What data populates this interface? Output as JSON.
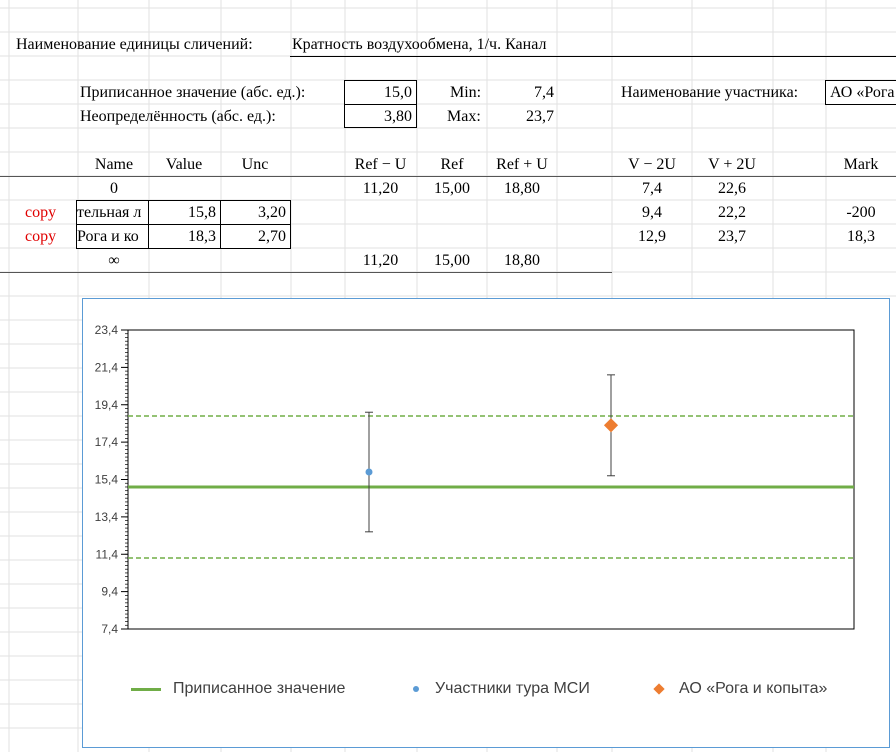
{
  "header": {
    "label": "Наименование единицы сличений:",
    "value": "Кратность воздухообмена, 1/ч. Канал"
  },
  "params": {
    "assigned_label": "Приписанное значение (абс. ед.):",
    "assigned_value": "15,0",
    "uncertainty_label": "Неопределённость (абс. ед.):",
    "uncertainty_value": "3,80",
    "min_label": "Min:",
    "min_value": "7,4",
    "max_label": "Max:",
    "max_value": "23,7",
    "participant_label": "Наименование участника:",
    "participant_value": "АО «Рога"
  },
  "table": {
    "headers": {
      "name": "Name",
      "value": "Value",
      "unc": "Unc",
      "ref_minus_u": "Ref − U",
      "ref": "Ref",
      "ref_plus_u": "Ref + U",
      "v_minus_2u": "V − 2U",
      "v_plus_2u": "V + 2U",
      "mark": "Mark"
    },
    "rows": [
      {
        "copy": "",
        "name": "0",
        "value": "",
        "unc": "",
        "ref_minus_u": "11,20",
        "ref": "15,00",
        "ref_plus_u": "18,80",
        "v_minus_2u": "7,4",
        "v_plus_2u": "22,6",
        "mark": ""
      },
      {
        "copy": "copy",
        "name": "тельная л",
        "value": "15,8",
        "unc": "3,20",
        "ref_minus_u": "",
        "ref": "",
        "ref_plus_u": "",
        "v_minus_2u": "9,4",
        "v_plus_2u": "22,2",
        "mark": "-200"
      },
      {
        "copy": "copy",
        "name": "Рога и ко",
        "value": "18,3",
        "unc": "2,70",
        "ref_minus_u": "",
        "ref": "",
        "ref_plus_u": "",
        "v_minus_2u": "12,9",
        "v_plus_2u": "23,7",
        "mark": "18,3"
      },
      {
        "copy": "",
        "name": "∞",
        "value": "",
        "unc": "",
        "ref_minus_u": "11,20",
        "ref": "15,00",
        "ref_plus_u": "18,80",
        "v_minus_2u": "",
        "v_plus_2u": "",
        "mark": ""
      }
    ]
  },
  "chart_data": {
    "type": "scatter",
    "ylim": [
      7.4,
      23.4
    ],
    "y_ticks": [
      "23,4",
      "21,4",
      "19,4",
      "17,4",
      "15,4",
      "13,4",
      "11,4",
      "9,4",
      "7,4"
    ],
    "y_tick_values": [
      23.4,
      21.4,
      19.4,
      17.4,
      15.4,
      13.4,
      11.4,
      9.4,
      7.4
    ],
    "assigned_value": 15.0,
    "ref_minus_u": 11.2,
    "ref_plus_u": 18.8,
    "series": [
      {
        "name": "Участники тура МСИ",
        "points": [
          {
            "value": 15.8,
            "unc": 3.2
          }
        ]
      },
      {
        "name": "АО «Рога и копыта»",
        "points": [
          {
            "value": 18.3,
            "unc": 2.7
          }
        ]
      }
    ],
    "legend": [
      "Приписанное значение",
      "Участники тура МСИ",
      "АО «Рога и копыта»"
    ],
    "legend_position": "bottom",
    "colors": {
      "assigned": "#70ad47",
      "bounds": "#70ad47",
      "participants": "#5b9bd5",
      "company": "#ed7d31",
      "errorbar": "#404040"
    }
  }
}
